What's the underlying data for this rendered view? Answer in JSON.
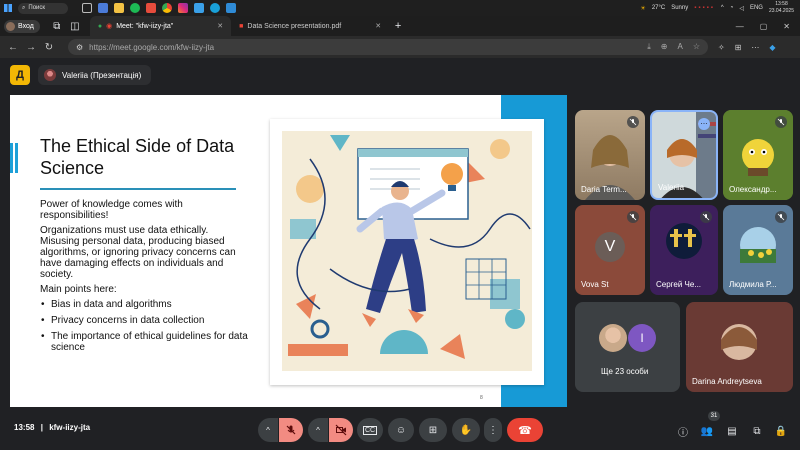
{
  "taskbar": {
    "search_placeholder": "Поиск",
    "weather": "27°C",
    "weather_desc": "Sunny",
    "language": "ENG",
    "time": "13:58",
    "date": "23.04.2025"
  },
  "browser": {
    "profile_label": "Вход",
    "tabs": [
      {
        "label": "Meet: \"kfw-iizy-jta\"",
        "active": true
      },
      {
        "label": "Data Science presentation.pdf",
        "active": false
      }
    ],
    "url": "https://meet.google.com/kfw-iizy-jta"
  },
  "meet": {
    "logo_letter": "Д",
    "presenter_label": "Valeriia (Презентація)",
    "meeting_time": "13:58",
    "meeting_code": "kfw-iizy-jta",
    "participants_count": "31"
  },
  "slide": {
    "title": "The Ethical Side of Data Science",
    "intro": "Power of knowledge comes with responsibilities!",
    "paragraph": "Organizations must use data ethically. Misusing personal data, producing biased algorithms, or ignoring privacy concerns can have damaging effects on individuals and society.",
    "main_points_label": "Main points here:",
    "bullets": [
      "Bias in data and algorithms",
      "Privacy concerns in data collection",
      "The importance of ethical guidelines for data science"
    ],
    "page_number": "8"
  },
  "participants": [
    {
      "name": "Daria Term..."
    },
    {
      "name": "Valeriia"
    },
    {
      "name": "Олександр..."
    },
    {
      "name": "Vova St",
      "initial": "V"
    },
    {
      "name": "Сергей Че..."
    },
    {
      "name": "Людмила Р..."
    },
    {
      "name": "Ще 23 особи",
      "initial": "I"
    },
    {
      "name": "Darina Andreytseva"
    }
  ]
}
